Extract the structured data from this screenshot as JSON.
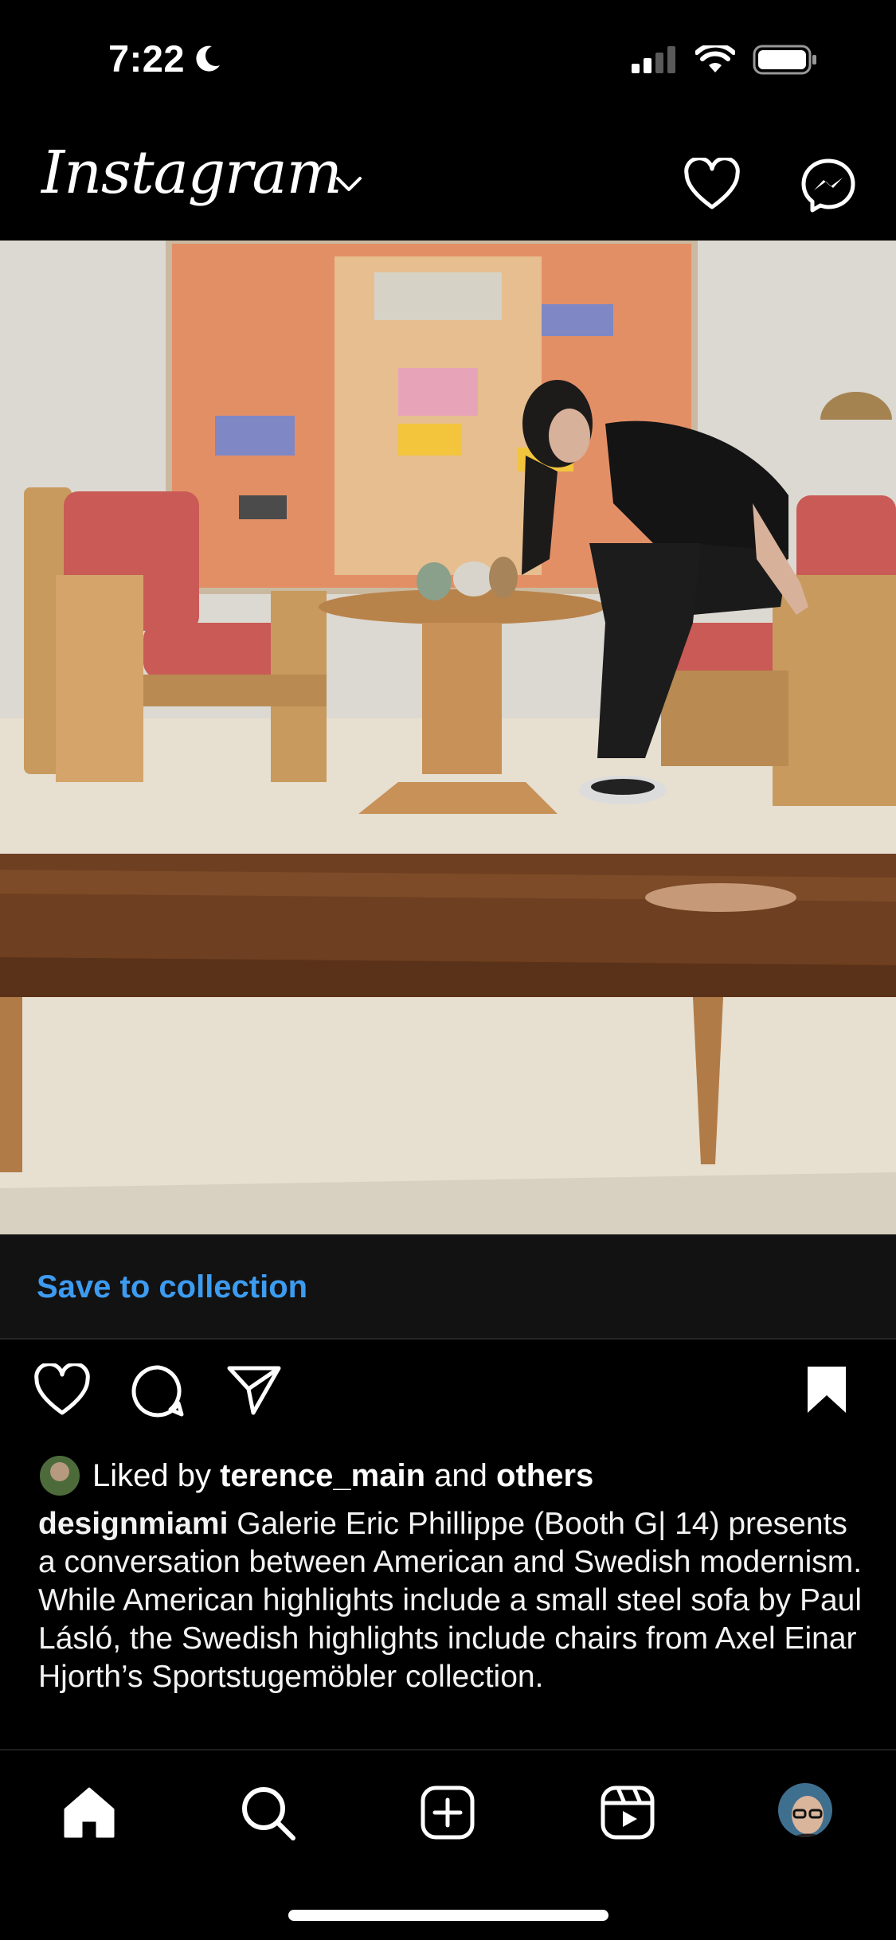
{
  "status_bar": {
    "time": "7:22",
    "icons": [
      "moon-icon",
      "signal-icon",
      "wifi-icon",
      "battery-icon"
    ]
  },
  "header": {
    "brand": "Instagram",
    "icons": [
      "chevron-down-icon",
      "heart-icon",
      "messenger-icon"
    ]
  },
  "post": {
    "photo_description_icon": "photo",
    "save_to_collection": "Save to collection",
    "actions": [
      "like-icon",
      "comment-icon",
      "share-icon",
      "bookmark-icon"
    ],
    "likes": {
      "prefix": "Liked by",
      "user": "terence_main",
      "connector": "and",
      "others": "others"
    },
    "caption": {
      "username": "designmiami",
      "text": "Galerie Eric Phillippe (Booth G| 14) presents a conversation between American and Swedish modernism. While American highlights include a small steel sofa by Paul Lásló, the Swedish highlights include chairs from Axel Einar Hjorth’s Sportstugemöbler collection."
    }
  },
  "bottom_nav": {
    "items": [
      "home-icon",
      "search-icon",
      "create-icon",
      "reels-icon",
      "profile-avatar"
    ]
  },
  "colors": {
    "background": "#000000",
    "link": "#3d9bf0",
    "save_bar": "#121212"
  }
}
